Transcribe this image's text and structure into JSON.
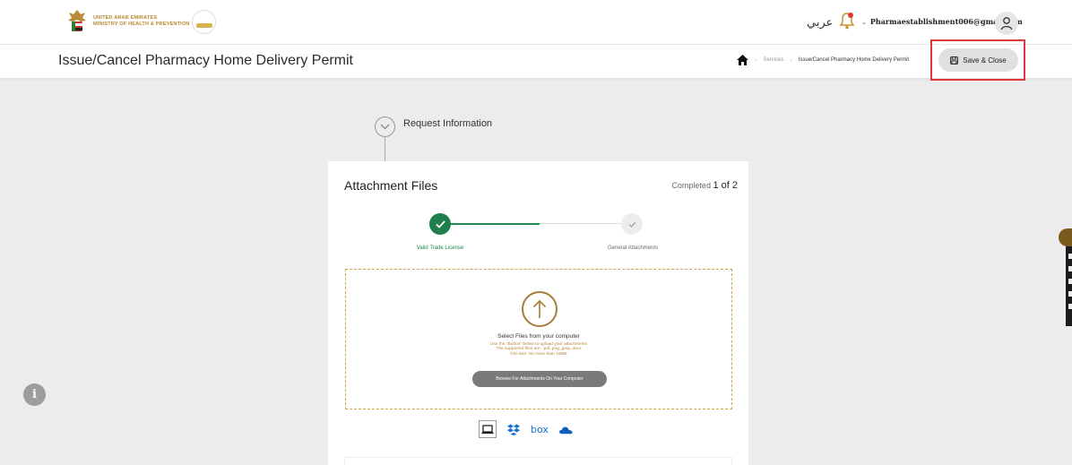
{
  "header": {
    "ministry_line1": "UNITED ARAB EMIRATES",
    "ministry_line2": "MINISTRY OF HEALTH & PREVENTION",
    "language_toggle": "عربي",
    "user_email": "Pharmaestablishment006@gmail.com"
  },
  "page": {
    "title": "Issue/Cancel Pharmacy Home Delivery Permit",
    "breadcrumb": [
      "Services",
      "Issue/Cancel Pharmacy Home Delivery Permit"
    ],
    "save_close_label": "Save & Close"
  },
  "section": {
    "step_title": "Request Information"
  },
  "card": {
    "title": "Attachment Files",
    "completed_prefix": "Completed",
    "completed_value": "1 of 2",
    "stages": [
      {
        "label": "Valid Trade License",
        "status": "done"
      },
      {
        "label": "General Attachments",
        "status": "pending"
      }
    ],
    "dropzone": {
      "title": "Select Files from your computer",
      "help_line1": "Use the \"Button\" below to upload your attachments",
      "help_line2": "The supported files are: .pdf,.png,.jpeg,.docx",
      "size_note": "File size: No more than 10MB",
      "browse_label": "Browse For Attachments On Your Computer"
    },
    "sources": {
      "box_label": "box",
      "icons": [
        "laptop-icon",
        "dropbox-icon",
        "box-icon",
        "onedrive-icon"
      ]
    }
  },
  "colors": {
    "accent_gold": "#b7893c",
    "success_green": "#1e7f4d",
    "highlight_red": "#e23636"
  }
}
